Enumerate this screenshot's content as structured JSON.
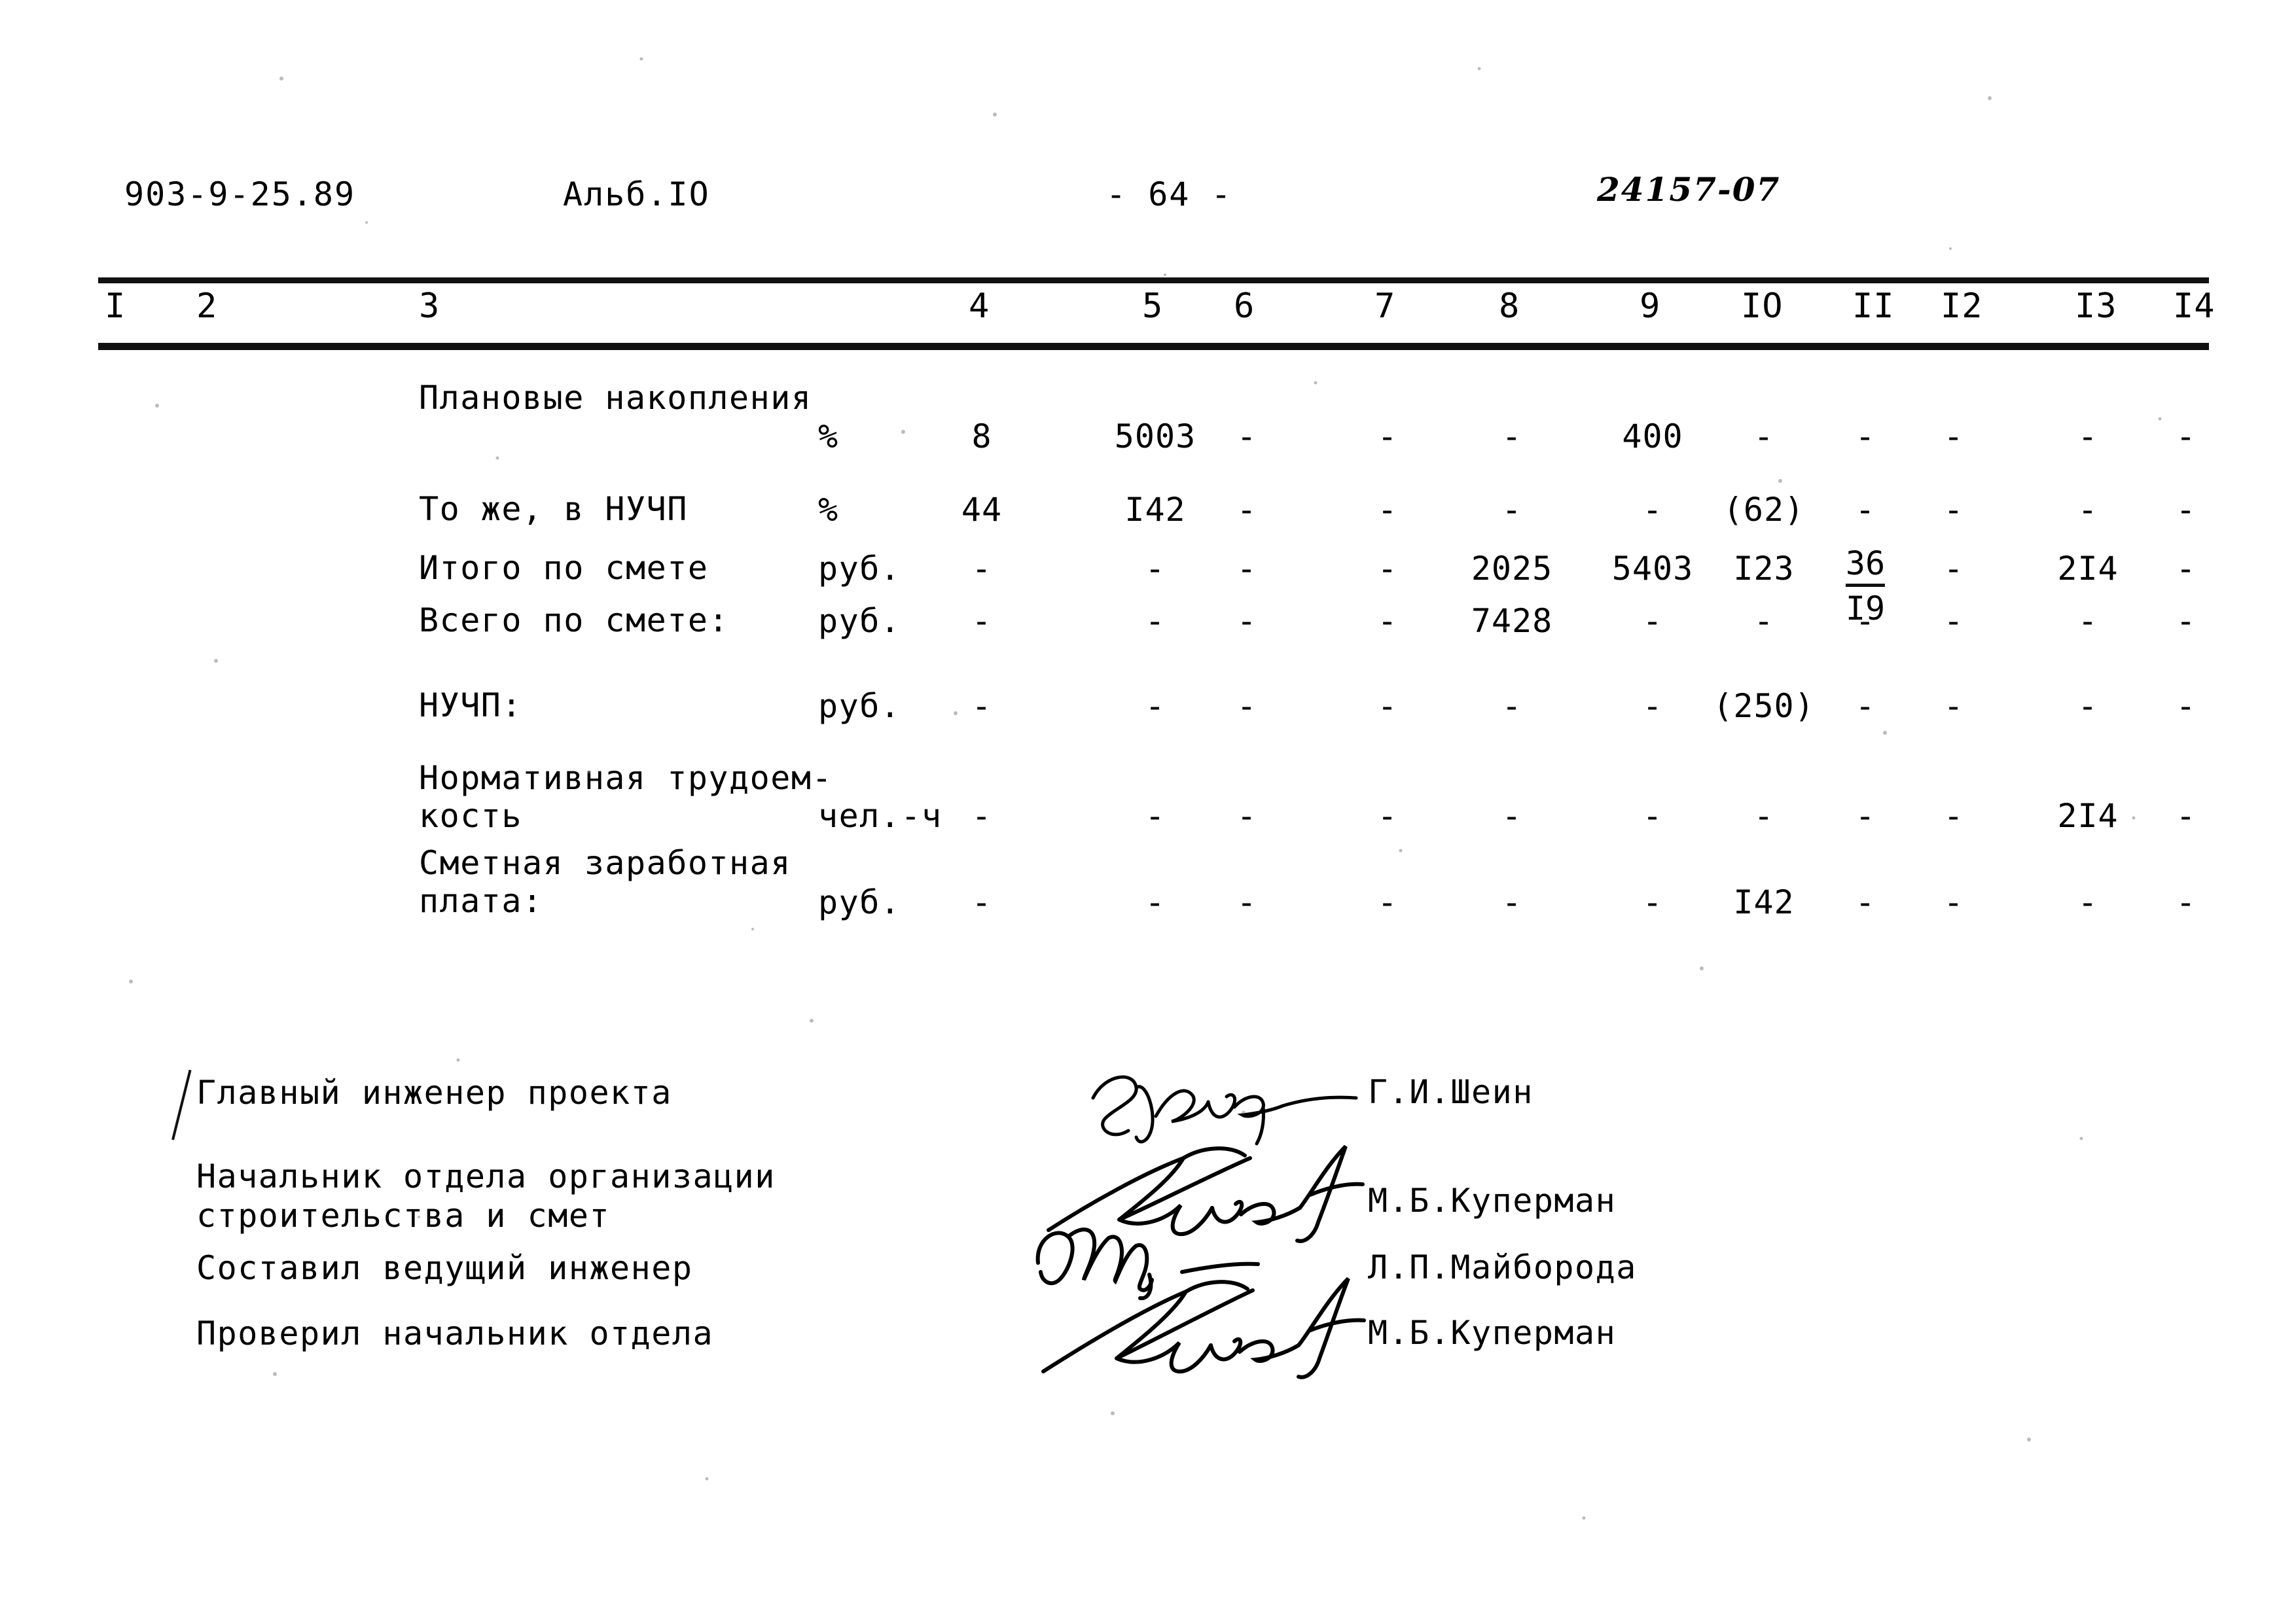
{
  "document": {
    "header": {
      "code": "903-9-25.89",
      "album": "Альб.IO",
      "page": "- 64 -",
      "drawing_number": "24157-07"
    },
    "table": {
      "column_numbers": [
        "I",
        "2",
        "3",
        "4",
        "5",
        "6",
        "7",
        "8",
        "9",
        "IO",
        "II",
        "I2",
        "I3",
        "I4"
      ],
      "rows": [
        {
          "label": "Плановые накопления",
          "label2": "",
          "unit": "%",
          "c4": "8",
          "c5": "5003",
          "c6": "-",
          "c7": "-",
          "c8": "-",
          "c9": "400",
          "c10": "-",
          "c11": "-",
          "c12": "-",
          "c13": "-",
          "c14": "-"
        },
        {
          "label": "То же, в НУЧП",
          "label2": "",
          "unit": "%",
          "c4": "44",
          "c5": "I42",
          "c6": "-",
          "c7": "-",
          "c8": "-",
          "c9": "-",
          "c10": "(62)",
          "c11": "-",
          "c12": "-",
          "c13": "-",
          "c14": "-"
        },
        {
          "label": "Итого по смете",
          "label2": "",
          "unit": "руб.",
          "c4": "-",
          "c5": "-",
          "c6": "-",
          "c7": "-",
          "c8": "2025",
          "c9": "5403",
          "c10": "I23",
          "c11_numerator": "36",
          "c11_denominator": "I9",
          "c12": "-",
          "c13": "2I4",
          "c14": "-"
        },
        {
          "label": "Всего по смете:",
          "label2": "",
          "unit": "руб.",
          "c4": "-",
          "c5": "-",
          "c6": "-",
          "c7": "-",
          "c8": "7428",
          "c9": "-",
          "c10": "-",
          "c11": "-",
          "c12": "-",
          "c13": "-",
          "c14": "-"
        },
        {
          "label": "НУЧП:",
          "label2": "",
          "unit": "руб.",
          "c4": "-",
          "c5": "-",
          "c6": "-",
          "c7": "-",
          "c8": "-",
          "c9": "-",
          "c10": "(250)",
          "c11": "-",
          "c12": "-",
          "c13": "-",
          "c14": "-"
        },
        {
          "label": "Нормативная трудоем-",
          "label2": "кость",
          "unit": "чел.-ч",
          "c4": "-",
          "c5": "-",
          "c6": "-",
          "c7": "-",
          "c8": "-",
          "c9": "-",
          "c10": "-",
          "c11": "-",
          "c12": "-",
          "c13": "2I4",
          "c14": "-"
        },
        {
          "label": "Сметная заработная",
          "label2": "плата:",
          "unit": "руб.",
          "c4": "-",
          "c5": "-",
          "c6": "-",
          "c7": "-",
          "c8": "-",
          "c9": "-",
          "c10": "I42",
          "c11": "-",
          "c12": "-",
          "c13": "-",
          "c14": "-"
        }
      ]
    },
    "signatures": [
      {
        "title": "Главный инженер проекта",
        "title2": "",
        "name": "Г.И.Шеин"
      },
      {
        "title": "Начальник отдела организации",
        "title2": "строительства и смет",
        "name": "М.Б.Куперман"
      },
      {
        "title": "Составил ведущий  инженер",
        "title2": "",
        "name": "Л.П.Майборода"
      },
      {
        "title": "Проверил начальник отдела",
        "title2": "",
        "name": "М.Б.Куперман"
      }
    ],
    "colors": {
      "ink": "#000000",
      "paper": "#ffffff"
    }
  }
}
